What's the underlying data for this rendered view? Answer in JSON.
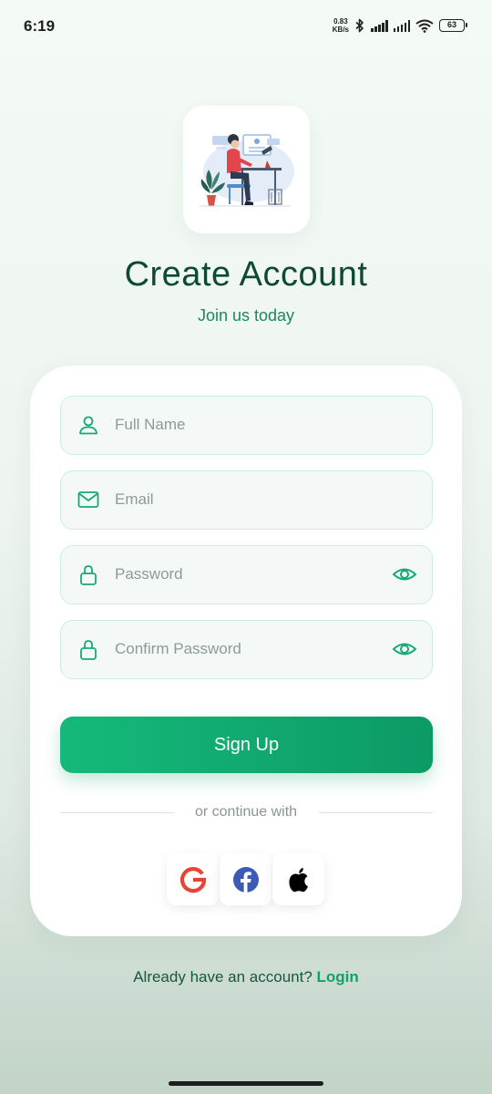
{
  "status_bar": {
    "time": "6:19",
    "net_speed_value": "0.83",
    "net_speed_unit": "KB/s",
    "battery": "63",
    "icons": [
      "bluetooth-icon",
      "signal-icon",
      "signal-icon",
      "wifi-icon",
      "battery-icon"
    ]
  },
  "header": {
    "logo": "desk-illustration",
    "title": "Create Account",
    "subtitle": "Join us today"
  },
  "form": {
    "full_name": {
      "placeholder": "Full Name",
      "icon": "user-icon"
    },
    "email": {
      "placeholder": "Email",
      "icon": "mail-icon"
    },
    "password": {
      "placeholder": "Password",
      "icon": "lock-icon",
      "toggle_icon": "eye-icon"
    },
    "confirm_password": {
      "placeholder": "Confirm Password",
      "icon": "lock-icon",
      "toggle_icon": "eye-icon"
    },
    "submit_label": "Sign Up"
  },
  "social": {
    "divider_text": "or continue with",
    "providers": [
      "google-icon",
      "facebook-icon",
      "apple-icon"
    ]
  },
  "footer": {
    "prompt": "Already have an account?",
    "link_label": "Login"
  },
  "colors": {
    "accent": "#13a06a",
    "title": "#0c4a34",
    "field_border": "#c8efe0",
    "field_bg": "#f4f9f7"
  }
}
